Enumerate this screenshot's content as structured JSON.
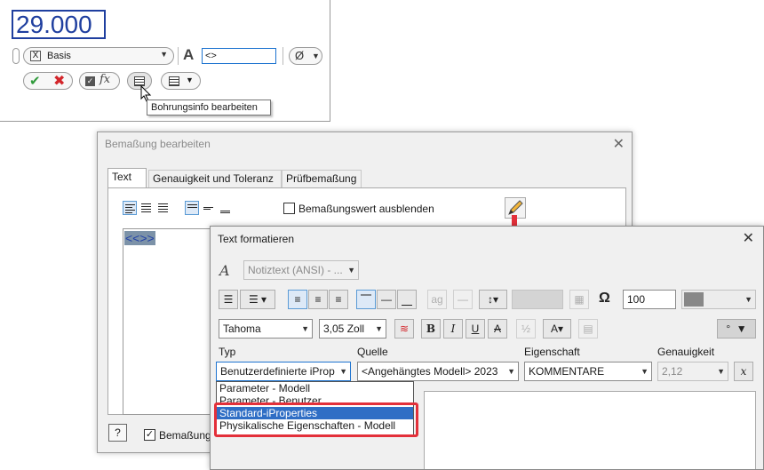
{
  "mini_toolbar": {
    "dimension_value": "29.000",
    "style_name": "Basis",
    "text_field_value": "<>",
    "diameter_symbol": "Ø",
    "tooltip": "Bohrungsinfo bearbeiten"
  },
  "dialog_edit_dimension": {
    "title": "Bemaßung bearbeiten",
    "tabs": [
      "Text",
      "Genauigkeit und Toleranz",
      "Prüfbemaßung"
    ],
    "hide_value_label": "Bemaßungswert ausblenden",
    "hide_value_checked": false,
    "text_content": "<<>>",
    "bottom_checkbox_label": "Bemaßung",
    "bottom_checkbox_checked": true
  },
  "dialog_format_text": {
    "title": "Text formatieren",
    "style_combo": "Notiztext (ANSI) - ...",
    "font": "Tahoma",
    "font_size": "3,05 Zoll",
    "width_percent": "100",
    "labels": {
      "typ": "Typ",
      "quelle": "Quelle",
      "eigenschaft": "Eigenschaft",
      "genauigkeit": "Genauigkeit"
    },
    "typ_value": "Benutzerdefinierte iProp",
    "quelle_value": "<Angehängtes Modell> 2023",
    "eigenschaft_value": "KOMMENTARE",
    "genauigkeit_value": "2,12",
    "typ_options": [
      "Parameter - Modell",
      "Parameter - Benutzer",
      "Standard-iProperties",
      "Physikalische Eigenschaften - Modell"
    ],
    "typ_selected_index": 2
  },
  "colors": {
    "accent_blue": "#2f6ec5",
    "highlight_red": "#e3303a",
    "dimension_blue": "#1f3f9f",
    "ok_green": "#2f9a3a"
  }
}
